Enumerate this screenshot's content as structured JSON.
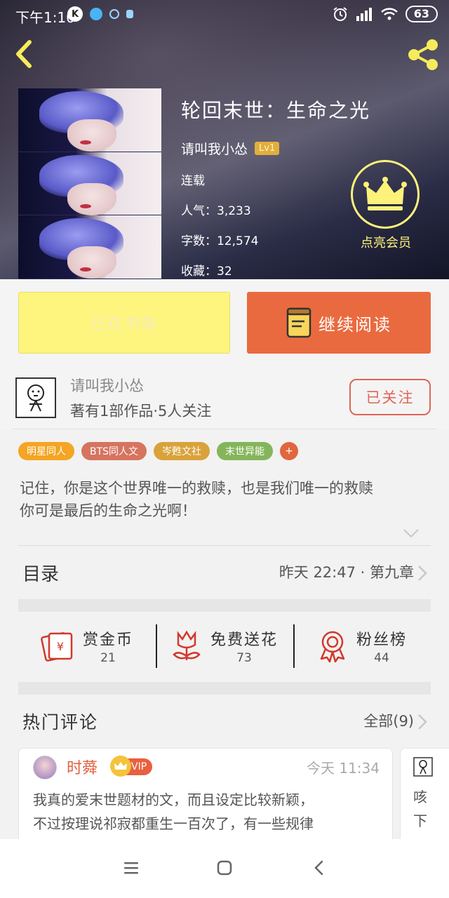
{
  "status_bar": {
    "time": "下午1:10",
    "app_icons": [
      "k-app-icon",
      "bird-app-icon",
      "smile-app-icon",
      "ghost-app-icon"
    ],
    "battery": "63"
  },
  "book": {
    "title": "轮回末世：生命之光",
    "author": "请叫我小怂",
    "level": "Lv1",
    "status": "连载",
    "popularity": "人气：3,233",
    "word_count": "字数：12,574",
    "favorites": "收藏：32",
    "vip_label": "点亮会员"
  },
  "actions": {
    "shelf_label": "已在书架",
    "read_label": "继续阅读"
  },
  "author_card": {
    "name": "请叫我小怂",
    "stats": "著有1部作品·5人关注",
    "follow_label": "已关注"
  },
  "tags": [
    {
      "label": "明星同人",
      "color": "#f4a523"
    },
    {
      "label": "BTS同人文",
      "color": "#d6745f"
    },
    {
      "label": "岑甦文社",
      "color": "#d9a23a"
    },
    {
      "label": "末世异能",
      "color": "#85b55b"
    }
  ],
  "tag_more": "+",
  "summary": {
    "line1": "记住，你是这个世界唯一的救赎，也是我们唯一的救赎",
    "line2": "你可是最后的生命之光啊！"
  },
  "toc": {
    "title": "目录",
    "latest": "昨天 22:47 · 第九章"
  },
  "rewards": [
    {
      "label": "赏金币",
      "count": "21",
      "icon": "red-envelope-icon"
    },
    {
      "label": "免费送花",
      "count": "73",
      "icon": "flower-icon"
    },
    {
      "label": "粉丝榜",
      "count": "44",
      "icon": "medal-icon"
    }
  ],
  "comments": {
    "title": "热门评论",
    "all_label": "全部(9)",
    "items": [
      {
        "user": "时蕣",
        "badge": "VIP",
        "time": "今天 11:34",
        "line1": "我真的爱末世题材的文，而且设定比较新颖，",
        "line2": "不过按理说祁寂都重生一百次了，有一些规律"
      },
      {
        "line1": "咳",
        "line2": "下"
      }
    ]
  },
  "colors": {
    "accent_orange": "#ea6a3f",
    "shelf_yellow": "#fdf57d",
    "vip_yellow": "#fff27a"
  }
}
